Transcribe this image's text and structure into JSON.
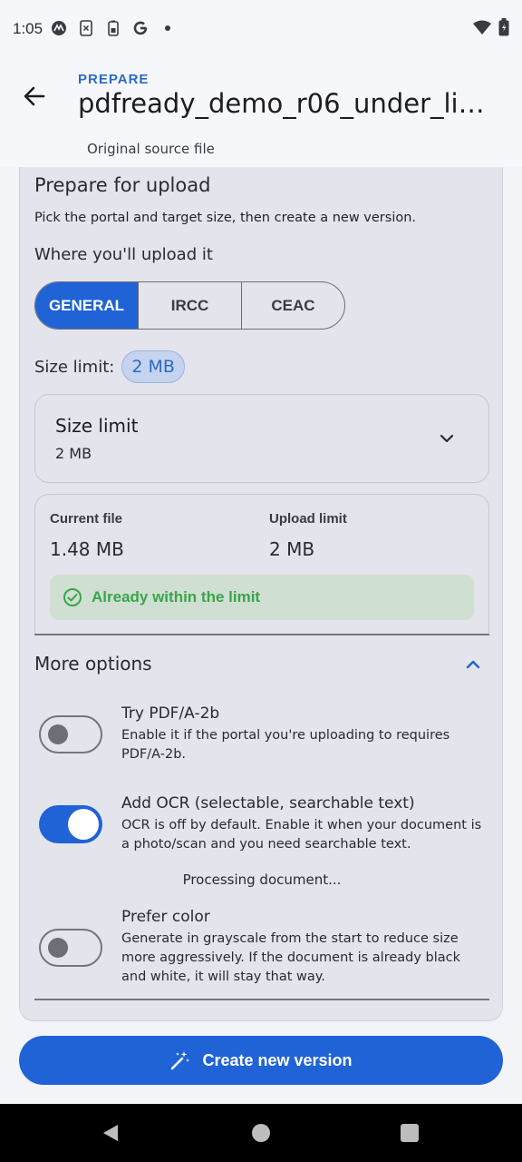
{
  "status_bar": {
    "time": "1:05",
    "icons_left": [
      "motorola-icon",
      "sim-icon",
      "battery-saver-icon",
      "google-icon",
      "dot-icon"
    ],
    "icons_right": [
      "wifi-icon",
      "battery-icon"
    ]
  },
  "app_bar": {
    "overline": "PREPARE",
    "title": "pdfready_demo_r06_under_limit.pdf",
    "subtitle": "Original source file"
  },
  "prepare": {
    "title": "Prepare for upload",
    "description": "Pick the portal and target size, then create a new version.",
    "where_label": "Where you'll upload it",
    "portals": [
      {
        "label": "GENERAL",
        "selected": true
      },
      {
        "label": "IRCC",
        "selected": false
      },
      {
        "label": "CEAC",
        "selected": false
      }
    ],
    "size_limit_label": "Size limit:",
    "size_limit_chip": "2 MB",
    "dropdown": {
      "label": "Size limit",
      "value": "2 MB"
    },
    "current_file_label": "Current file",
    "current_file_value": "1.48 MB",
    "upload_limit_label": "Upload limit",
    "upload_limit_value": "2 MB",
    "status_text": "Already within the limit"
  },
  "more_options": {
    "title": "More options",
    "options": [
      {
        "title": "Try PDF/A-2b",
        "description": "Enable it if the portal you're uploading to requires PDF/A-2b.",
        "enabled": false
      },
      {
        "title": "Add OCR (selectable, searchable text)",
        "description": "OCR is off by default. Enable it when your document is a photo/scan and you need searchable text.",
        "enabled": true
      },
      {
        "title": "Prefer color",
        "description": "Generate in grayscale from the start to reduce size more aggressively. If the document is already black and white, it will stay that way.",
        "enabled": false
      }
    ],
    "processing_text": "Processing document..."
  },
  "actions": {
    "create_label": "Create new version"
  },
  "colors": {
    "accent": "#1f63d6",
    "overline": "#2c6bc6",
    "success": "#39a54a",
    "success_bg": "#cfdfd2",
    "card_bg": "#e3e4ec"
  }
}
